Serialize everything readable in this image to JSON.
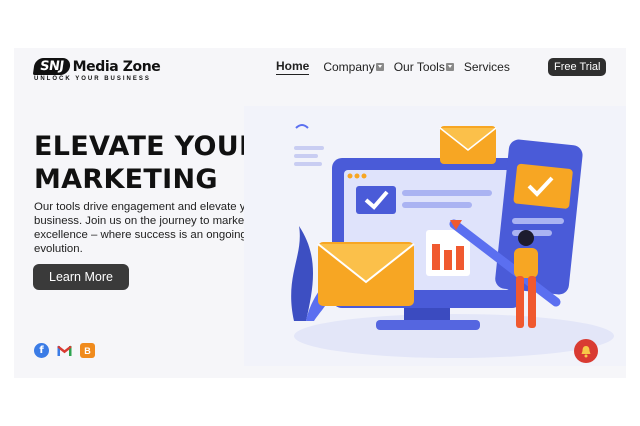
{
  "brand": {
    "badge": "SNJ",
    "name": "Media Zone",
    "tagline": "UNLOCK YOUR BUSINESS"
  },
  "nav": {
    "items": [
      {
        "label": "Home",
        "active": true
      },
      {
        "label": "Company",
        "dropdown": true
      },
      {
        "label": "Our Tools",
        "dropdown": true
      },
      {
        "label": "Services"
      }
    ],
    "cta": "Free Trial"
  },
  "hero": {
    "title_line1": "ELEVATE YOUR",
    "title_line2": "MARKETING",
    "description": "Our tools drive engagement and elevate your business. Join us on the journey to marketing excellence – where success is an ongoing evolution.",
    "button": "Learn More"
  },
  "socials": [
    {
      "icon": "facebook-icon",
      "glyph": "f",
      "color": "#3b7ce6"
    },
    {
      "icon": "gmail-icon",
      "glyph": "M",
      "color": "#d93b32"
    },
    {
      "icon": "blogger-icon",
      "glyph": "B",
      "color": "#f08b1d"
    }
  ],
  "colors": {
    "accent_blue": "#5b6ff0",
    "accent_orange": "#f7a623",
    "dark_button": "#3a3a3a",
    "notification": "#d93b32"
  }
}
